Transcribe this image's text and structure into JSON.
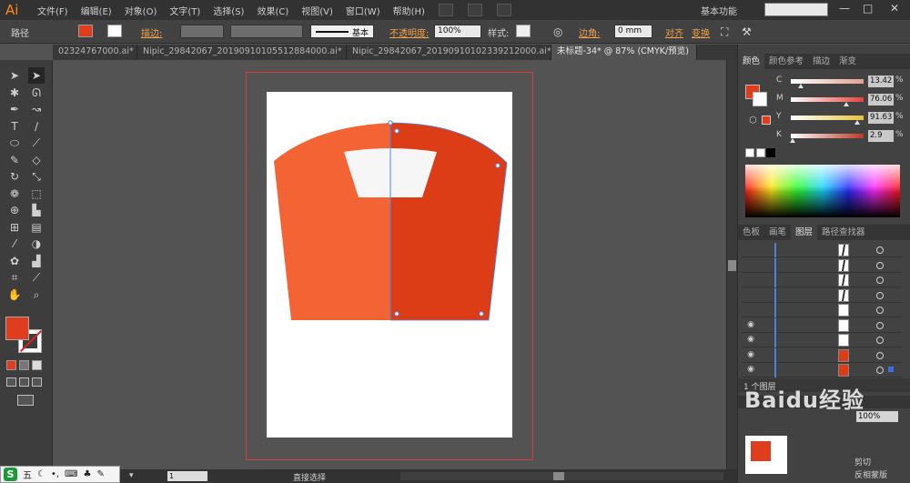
{
  "app": {
    "logo": "Ai",
    "menus": [
      "文件(F)",
      "编辑(E)",
      "对象(O)",
      "文字(T)",
      "选择(S)",
      "效果(C)",
      "视图(V)",
      "窗口(W)",
      "帮助(H)"
    ],
    "workspace": "基本功能",
    "window_controls": [
      "—",
      "□",
      "✕"
    ]
  },
  "control_bar": {
    "object_type": "路径",
    "stroke_label": "描边:",
    "stroke_style": "基本",
    "opacity_label": "不透明度:",
    "opacity_value": "100%",
    "style_label": "样式:",
    "corner_label": "边角:",
    "corner_value": "0 mm",
    "align_label": "对齐",
    "transform_label": "变换",
    "fill_color": "#e03d1e"
  },
  "tabs": [
    {
      "label": "02324767000.ai*",
      "active": false
    },
    {
      "label": "Nipic_29842067_20190910105512884000.ai*",
      "active": false
    },
    {
      "label": "Nipic_29842067_20190910102339212000.ai*",
      "active": false
    },
    {
      "label": "未标题-34* @ 87% (CMYK/预览)",
      "active": true
    }
  ],
  "tools": [
    "selection-icon",
    "direct-selection-icon",
    "magic-wand-icon",
    "lasso-icon",
    "pen-icon",
    "curvature-icon",
    "type-icon",
    "line-icon",
    "ellipse-icon",
    "paintbrush-icon",
    "pencil-icon",
    "eraser-icon",
    "rotate-icon",
    "scale-icon",
    "warp-icon",
    "free-transform-icon",
    "shape-builder-icon",
    "chart-icon",
    "mesh-icon",
    "gradient-icon",
    "eyedropper-icon",
    "blend-icon",
    "symbol-sprayer-icon",
    "column-graph-icon",
    "artboard-icon",
    "slice-icon",
    "hand-icon",
    "zoom-icon"
  ],
  "color_panel": {
    "tabs": [
      {
        "label": "颜色",
        "active": true
      },
      {
        "label": "颜色参考",
        "active": false
      },
      {
        "label": "描边",
        "active": false
      },
      {
        "label": "渐变",
        "active": false
      }
    ],
    "channels": [
      {
        "label": "C",
        "value": "13.42",
        "fraction": 0.1342,
        "color": "#e0a28f"
      },
      {
        "label": "M",
        "value": "76.06",
        "fraction": 0.7606,
        "color": "#e4433b"
      },
      {
        "label": "Y",
        "value": "91.63",
        "fraction": 0.9163,
        "color": "#e8c23a"
      },
      {
        "label": "K",
        "value": "2.9",
        "fraction": 0.029,
        "color": "#b83a27"
      }
    ],
    "percent_sign": "%"
  },
  "layers_panel": {
    "tabs": [
      {
        "label": "色板",
        "active": false
      },
      {
        "label": "画笔",
        "active": false
      },
      {
        "label": "图层",
        "active": true
      },
      {
        "label": "路径查找器",
        "active": false
      }
    ],
    "footer": "1 个图层"
  },
  "navigator": {
    "zoom": "100%",
    "options": [
      "剪切",
      "反相蒙版"
    ]
  },
  "status": {
    "zoom": "87%",
    "page": "1",
    "tool_name": "直接选择"
  },
  "watermark": "Baidu经验",
  "ime": {
    "logo": "S",
    "mode": "五"
  },
  "art": {
    "left_color": "#f36334",
    "right_color": "#dc3d17",
    "window_color": "#f6f6f6",
    "guide_color": "#4a86e8"
  }
}
